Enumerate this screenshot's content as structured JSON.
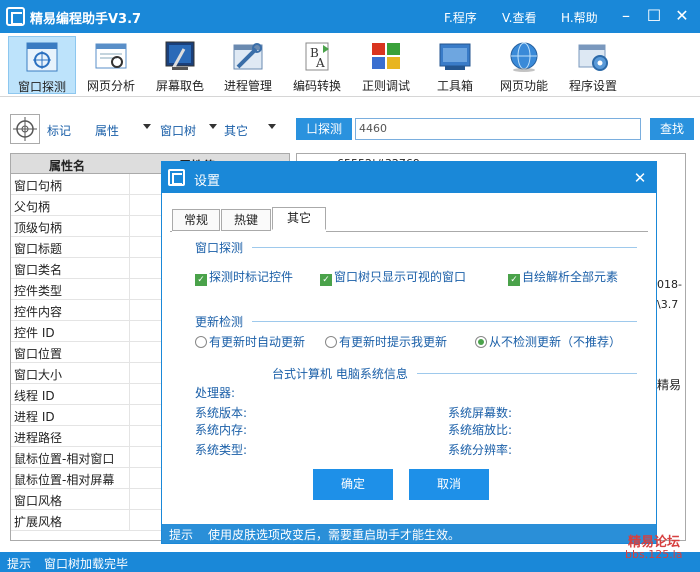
{
  "app": {
    "title": "精易编程助手V3.7",
    "menu": [
      "F.程序",
      "V.查看",
      "H.帮助"
    ]
  },
  "toolbar": {
    "items": [
      {
        "label": "窗口探测",
        "icon": "window-probe-icon"
      },
      {
        "label": "网页分析",
        "icon": "web-analysis-icon"
      },
      {
        "label": "屏幕取色",
        "icon": "color-picker-icon"
      },
      {
        "label": "进程管理",
        "icon": "process-manager-icon"
      },
      {
        "label": "编码转换",
        "icon": "encoding-convert-icon"
      },
      {
        "label": "正则调试",
        "icon": "regex-debug-icon"
      },
      {
        "label": "工具箱",
        "icon": "toolbox-icon"
      },
      {
        "label": "网页功能",
        "icon": "web-function-icon"
      },
      {
        "label": "程序设置",
        "icon": "program-settings-icon"
      }
    ]
  },
  "searchbar": {
    "mark": "标记",
    "attr": "属性",
    "tree": "窗口树",
    "other": "其它",
    "probe_btn": "ㄩ探测",
    "handle_value": "4460",
    "find_btn": "查找"
  },
  "proptable": {
    "col_name": "属性名",
    "col_value": "属性值",
    "rows": [
      "窗口句柄",
      "父句柄",
      "顶级句柄",
      "窗口标题",
      "窗口类名",
      "控件类型",
      "控件内容",
      "控件 ID",
      "窗口位置",
      "窗口大小",
      "线程 ID",
      "进程 ID",
      "进程路径",
      "鼠标位置-相对窗口",
      "鼠标位置-相对屏幕",
      "窗口风格",
      "扩展风格"
    ]
  },
  "tree": {
    "frag1": "65552|#32769",
    "frag2": "018-",
    "frag3": "\\3.7",
    "frag4": "精易"
  },
  "status": {
    "label": "提示",
    "text": "窗口树加载完毕"
  },
  "dialog": {
    "title": "设置",
    "tabs": [
      "常规",
      "热键",
      "其它"
    ],
    "sec_probe": "窗口探测",
    "checks": [
      "探测时标记控件",
      "窗口树只显示可视的窗口",
      "自绘解析全部元素"
    ],
    "sec_update": "更新检测",
    "radios": [
      "有更新时自动更新",
      "有更新时提示我更新",
      "从不检测更新（不推荐）"
    ],
    "sysinfo_title": "台式计算机 电脑系统信息",
    "cpu": "处理器:",
    "info_left": [
      "系统版本:",
      "系统内存:",
      "系统类型:"
    ],
    "info_right": [
      "系统屏幕数:",
      "系统缩放比:",
      "系统分辨率:"
    ],
    "ok": "确定",
    "cancel": "取消",
    "status_label": "提示",
    "status_text": "使用皮肤选项改变后，需要重启助手才能生效。"
  },
  "watermark": {
    "line1": "精易论坛",
    "line2": "bbs.125.la"
  },
  "colors": {
    "accent": "#1a88d8",
    "check": "#4aa24a",
    "text_blue": "#1a5fa8"
  }
}
